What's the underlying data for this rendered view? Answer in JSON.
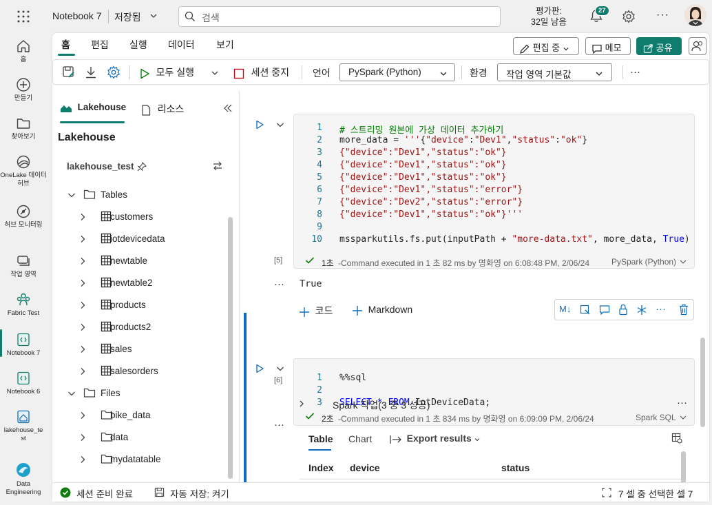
{
  "topbar": {
    "notebook_title": "Notebook 7",
    "saved_status": "저장됨",
    "search_placeholder": "검색",
    "trial_line1": "평가판:",
    "trial_line2": "32일 남음",
    "notification_count": "27"
  },
  "rail": {
    "items": [
      {
        "label": "홈",
        "icon": "home-icon"
      },
      {
        "label": "만들기",
        "icon": "plus-circle-icon"
      },
      {
        "label": "찾아보기",
        "icon": "folder-icon"
      },
      {
        "label": "OneLake 데이터 허브",
        "icon": "onelake-icon"
      },
      {
        "label": "허브 모니터링",
        "icon": "monitor-icon"
      },
      {
        "label": "작업 영역",
        "icon": "workspaces-icon"
      },
      {
        "label": "Fabric Test",
        "icon": "fabric-workspace-icon"
      },
      {
        "label": "Notebook 7",
        "icon": "notebook-icon"
      },
      {
        "label": "Notebook 6",
        "icon": "notebook-icon"
      },
      {
        "label": "lakehouse_test",
        "icon": "lakehouse-icon"
      },
      {
        "label": "Data Engineering",
        "icon": "data-engineering-icon"
      }
    ]
  },
  "menu": {
    "tabs": [
      "홈",
      "편집",
      "실행",
      "데이터",
      "보기"
    ],
    "edit_mode_label": "편집 중",
    "memo_label": "메모",
    "share_label": "공유"
  },
  "toolbar": {
    "run_all_label": "모두 실행",
    "stop_session_label": "세션 중지",
    "language_label": "언어",
    "language_value": "PySpark (Python)",
    "environment_label": "환경",
    "environment_value": "작업 영역 기본값",
    "more_label": "···"
  },
  "explorer": {
    "tab_lakehouse": "Lakehouse",
    "tab_resources": "리소스",
    "heading": "Lakehouse",
    "lakehouse_name": "lakehouse_test",
    "tables_label": "Tables",
    "tables": [
      "customers",
      "iotdevicedata",
      "newtable",
      "newtable2",
      "products",
      "products2",
      "sales",
      "salesorders"
    ],
    "files_label": "Files",
    "files": [
      "bike_data",
      "data",
      "mydatatable"
    ]
  },
  "cell1": {
    "lines": [
      "# 스트리밍 원본에 가상 데이터 추가하기",
      "more_data = '''{\"device\":\"Dev1\",\"status\":\"ok\"}",
      "{\"device\":\"Dev1\",\"status\":\"ok\"}",
      "{\"device\":\"Dev1\",\"status\":\"ok\"}",
      "{\"device\":\"Dev1\",\"status\":\"ok\"}",
      "{\"device\":\"Dev1\",\"status\":\"error\"}",
      "{\"device\":\"Dev2\",\"status\":\"error\"}",
      "{\"device\":\"Dev1\",\"status\":\"ok\"}'''",
      "",
      "mssparkutils.fs.put(inputPath + \"more-data.txt\", more_data, True)"
    ],
    "exec_count": "[5]",
    "exec_duration": "1초",
    "exec_text": "-Command executed in 1 초 82 ms by 명화영 on 6:08:48 PM, 2/06/24",
    "lang": "PySpark (Python)",
    "output": "True"
  },
  "add_cell": {
    "code_label": "코드",
    "markdown_label": "Markdown",
    "ml_label": "M↓"
  },
  "cell2": {
    "lines": [
      "%%sql",
      "",
      "SELECT * FROM IotDeviceData;"
    ],
    "exec_count": "[6]",
    "exec_duration": "2초",
    "exec_text": "-Command executed in 1 초 834 ms by 명화영 on 6:09:09 PM, 2/06/24",
    "lang": "Spark SQL",
    "spark_jobs": "Spark 작업(3 중 3 성공)"
  },
  "results": {
    "tab_table": "Table",
    "tab_chart": "Chart",
    "export_label": "Export results",
    "columns": [
      "Index",
      "device",
      "status"
    ]
  },
  "statusbar": {
    "session_ready": "세션 준비 완료",
    "autosave": "자동 저장: 켜기",
    "selection": "7 셀 중 선택한 셀 7"
  },
  "colors": {
    "accent": "#107c6d",
    "run": "#107c10",
    "stop": "#c50f1f",
    "cell_active": "#0f6cbd"
  }
}
